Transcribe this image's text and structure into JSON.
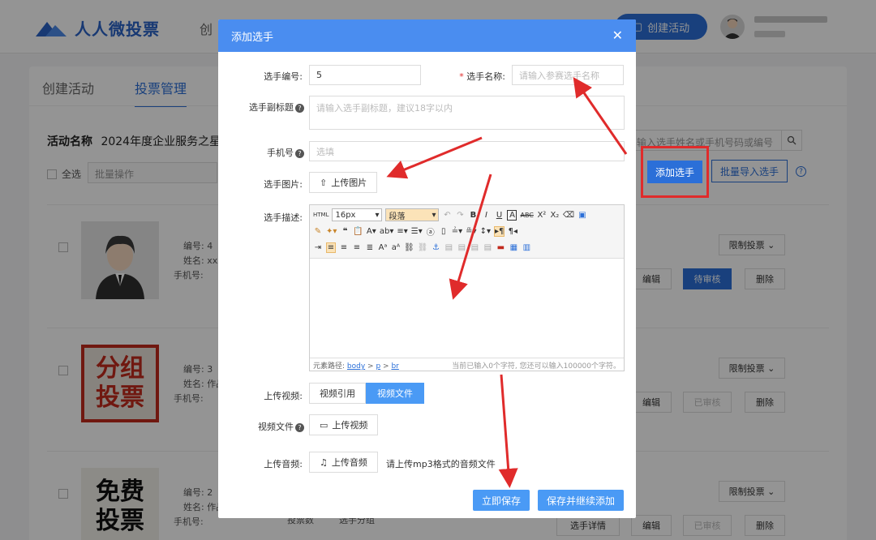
{
  "app": {
    "logo_text": "人人微投票",
    "nav_create": "创",
    "create_activity": "创建活动"
  },
  "tabs": [
    {
      "label": "创建活动"
    },
    {
      "label": "投票管理"
    }
  ],
  "activity": {
    "label": "活动名称",
    "name": "2024年度企业服务之星"
  },
  "toolbar": {
    "select_all": "全选",
    "batch_ops": "批量操作",
    "search_placeholder": "输入选手姓名或手机号码或编号",
    "add_player": "添加选手",
    "batch_import": "批量导入选手"
  },
  "cards": [
    {
      "no_label": "编号: 4",
      "name_label": "姓名: xxx",
      "phone_label": "手机号:",
      "limit": "限制投票",
      "edit": "编辑",
      "status": "待审核",
      "delete": "删除"
    },
    {
      "no_label": "编号: 3",
      "name_label": "姓名: 作品",
      "phone_label": "手机号:",
      "thumb": [
        "分组",
        "投票"
      ],
      "limit": "限制投票",
      "edit": "编辑",
      "status": "已审核",
      "delete": "删除"
    },
    {
      "no_label": "编号: 2",
      "name_label": "姓名: 作品",
      "phone_label": "手机号:",
      "thumb": [
        "免费",
        "投票"
      ],
      "limit": "限制投票",
      "detail": "选手详情",
      "edit": "编辑",
      "status": "已审核",
      "delete": "删除",
      "extra1": "投票数",
      "extra2": "选手分组"
    }
  ],
  "modal": {
    "title": "添加选手",
    "player_no_label": "选手编号:",
    "player_no_value": "5",
    "player_name_label": "选手名称:",
    "player_name_placeholder": "请输入参赛选手名称",
    "subtitle_label": "选手副标题",
    "subtitle_placeholder": "请输入选手副标题，建议18字以内",
    "phone_label": "手机号",
    "phone_placeholder": "选填",
    "image_label": "选手图片:",
    "upload_image": "上传图片",
    "desc_label": "选手描述:",
    "editor": {
      "font_size": "16px",
      "block_format": "段落",
      "path_label": "元素路径:",
      "path_body": "body",
      "path_p": "p",
      "path_br": "br",
      "count_text": "当前已输入0个字符, 您还可以输入100000个字符。"
    },
    "video_label": "上传视频:",
    "video_ref": "视频引用",
    "video_file": "视频文件",
    "video_file_label": "视频文件",
    "upload_video": "上传视频",
    "audio_label": "上传音频:",
    "upload_audio": "上传音频",
    "audio_hint": "请上传mp3格式的音频文件",
    "save": "立即保存",
    "save_continue": "保存并继续添加"
  },
  "colors": {
    "primary": "#2b6fd8",
    "modal_header": "#4a8df0",
    "annotation_red": "#e02b2b"
  }
}
